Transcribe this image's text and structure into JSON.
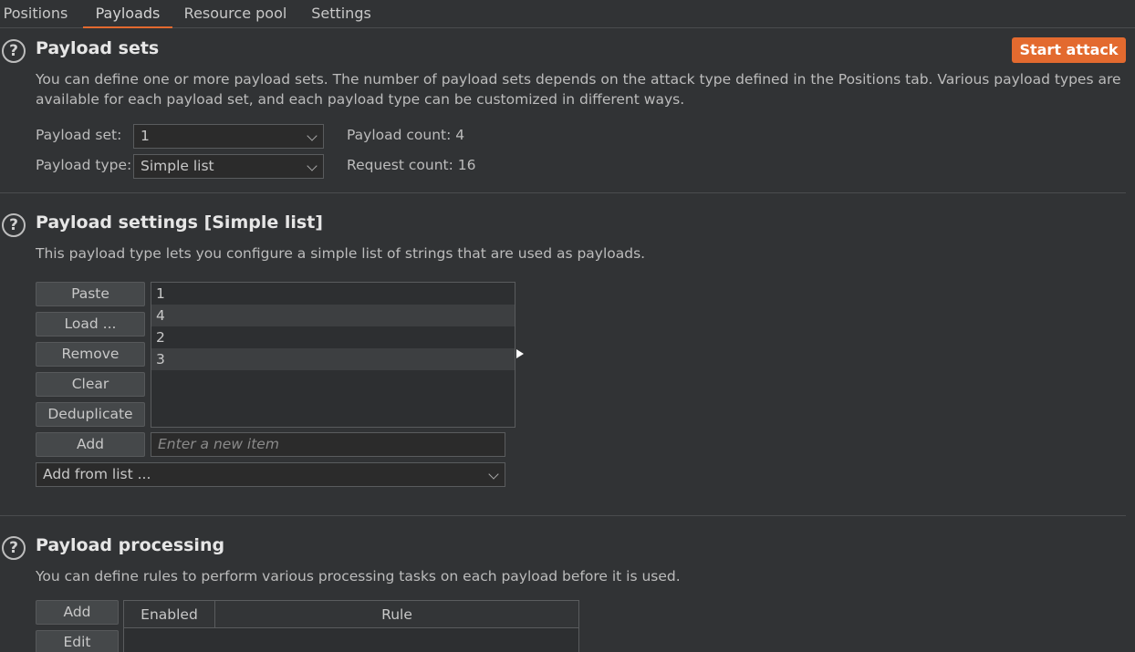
{
  "tabs": [
    {
      "label": "Positions"
    },
    {
      "label": "Payloads"
    },
    {
      "label": "Resource pool"
    },
    {
      "label": "Settings"
    }
  ],
  "payload_sets": {
    "title": "Payload sets",
    "start_button": "Start attack",
    "description_line1": "You can define one or more payload sets. The number of payload sets depends on the attack type defined in the Positions tab. Various payload types are",
    "description_line2": "available for each payload set, and each payload type can be customized in different ways.",
    "set_label": "Payload set:",
    "set_value": "1",
    "type_label": "Payload type:",
    "type_value": "Simple list",
    "payload_count": "Payload count: 4",
    "request_count": "Request count: 16"
  },
  "payload_settings": {
    "title": "Payload settings [Simple list]",
    "description": "This payload type lets you configure a simple list of strings that are used as payloads.",
    "buttons": {
      "paste": "Paste",
      "load": "Load ...",
      "remove": "Remove",
      "clear": "Clear",
      "deduplicate": "Deduplicate",
      "add": "Add"
    },
    "items": [
      "1",
      "4",
      "2",
      "3"
    ],
    "new_item_placeholder": "Enter a new item",
    "add_from_list": "Add from list ..."
  },
  "payload_processing": {
    "title": "Payload processing",
    "description": "You can define rules to perform various processing tasks on each payload before it is used.",
    "buttons": {
      "add": "Add",
      "edit": "Edit"
    },
    "columns": [
      "Enabled",
      "Rule"
    ]
  },
  "colors": {
    "accent": "#e36a2f",
    "background": "#313335"
  }
}
